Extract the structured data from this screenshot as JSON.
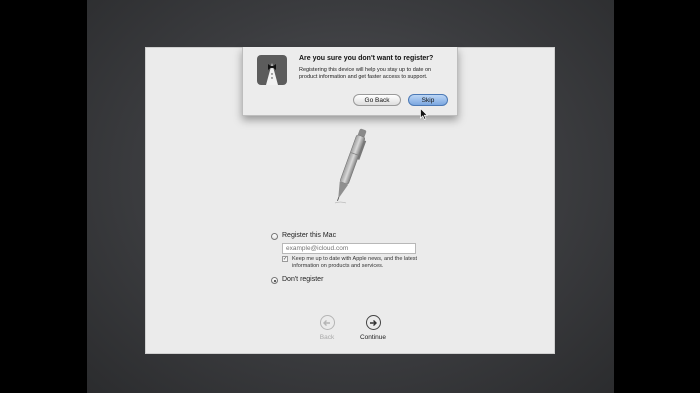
{
  "dialog": {
    "title": "Are you sure you don't want to register?",
    "message": "Registering this device will help you stay up to date on product information and get faster access to support.",
    "go_back_label": "Go Back",
    "skip_label": "Skip"
  },
  "registration": {
    "register_option_label": "Register this Mac",
    "email_placeholder": "example@icloud.com",
    "email_value": "",
    "keep_me_updated_label": "Keep me up to date with Apple news, and the latest information on products and services.",
    "keep_me_updated_checked": true,
    "dont_register_label": "Don't register",
    "selected_option": "dont_register"
  },
  "navigation": {
    "back_label": "Back",
    "continue_label": "Continue",
    "back_enabled": false
  },
  "icons": [
    "setup-assistant-tuxedo-icon",
    "pen-icon",
    "arrow-cursor-icon",
    "back-arrow-icon",
    "continue-arrow-icon"
  ],
  "colors": {
    "default_button": "#7ba7e0",
    "panel": "#ebebeb",
    "background": "#3b3c3f"
  }
}
